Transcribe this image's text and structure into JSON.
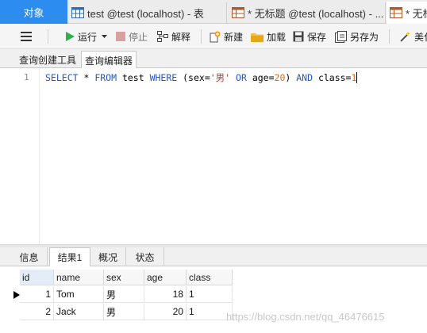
{
  "tabs": {
    "objects": "对象",
    "tab1": "test @test (localhost) - 表",
    "tab2": "* 无标题 @test (localhost) - ...",
    "tab3": "* 无标"
  },
  "toolbar": {
    "menu_icon": "hamburger-icon",
    "run": "运行",
    "stop": "停止",
    "explain": "解释",
    "new": "新建",
    "load": "加载",
    "save": "保存",
    "save_as": "另存为",
    "beautify": "美化"
  },
  "editor_tabs": {
    "builder": "查询创建工具",
    "editor": "查询编辑器"
  },
  "editor": {
    "line_number": "1",
    "sql": {
      "select": "SELECT",
      "star": " * ",
      "from": "FROM",
      "table": " test ",
      "where": "WHERE",
      "cond1_open": " (sex=",
      "string": "'男'",
      "or": " OR ",
      "cond2": "age=",
      "age_value": "20",
      "close": ") ",
      "and": "AND",
      "cond3": " class=",
      "class_value": "1"
    }
  },
  "result_tabs": {
    "info": "信息",
    "result1": "结果1",
    "overview": "概况",
    "status": "状态"
  },
  "results": {
    "columns": [
      "id",
      "name",
      "sex",
      "age",
      "class"
    ],
    "rows": [
      [
        "1",
        "Tom",
        "男",
        "18",
        "1"
      ],
      [
        "2",
        "Jack",
        "男",
        "20",
        "1"
      ]
    ]
  },
  "watermark": "https://blog.csdn.net/qq_46476615",
  "colors": {
    "accent": "#2d8cf0",
    "keyword": "#2457c5",
    "string": "#c0392b",
    "number": "#e46a16"
  }
}
